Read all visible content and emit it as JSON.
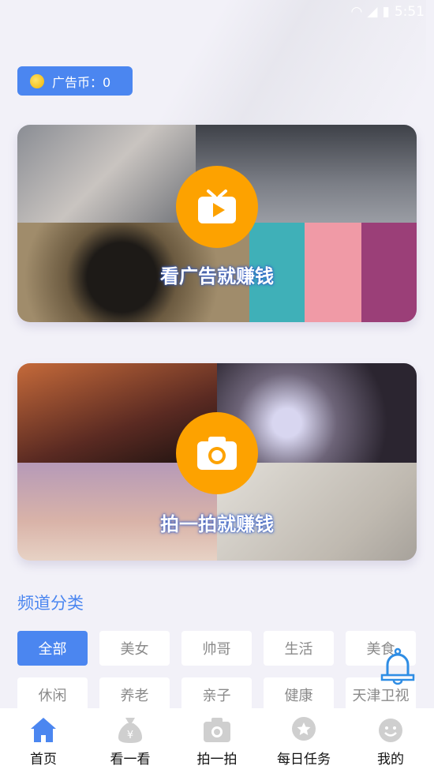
{
  "status_bar": {
    "time": "5:51"
  },
  "coin_badge": {
    "label": "广告币：0"
  },
  "banners": [
    {
      "label": "看广告就赚钱",
      "icon": "tv-play-icon"
    },
    {
      "label": "拍一拍就赚钱",
      "icon": "camera-icon"
    }
  ],
  "channels": {
    "title": "频道分类",
    "items": [
      "全部",
      "美女",
      "帅哥",
      "生活",
      "美食",
      "休闲",
      "养老",
      "亲子",
      "健康",
      "天津卫视"
    ],
    "active": "全部"
  },
  "nav": {
    "items": [
      {
        "label": "首页",
        "icon": "home-icon",
        "active": true
      },
      {
        "label": "看一看",
        "icon": "money-bag-icon"
      },
      {
        "label": "拍一拍",
        "icon": "camera-icon"
      },
      {
        "label": "每日任务",
        "icon": "star-badge-icon"
      },
      {
        "label": "我的",
        "icon": "smiley-icon"
      }
    ]
  },
  "colors": {
    "accent": "#4b86f0",
    "orange": "#fda200",
    "background": "#f2f1f8"
  }
}
